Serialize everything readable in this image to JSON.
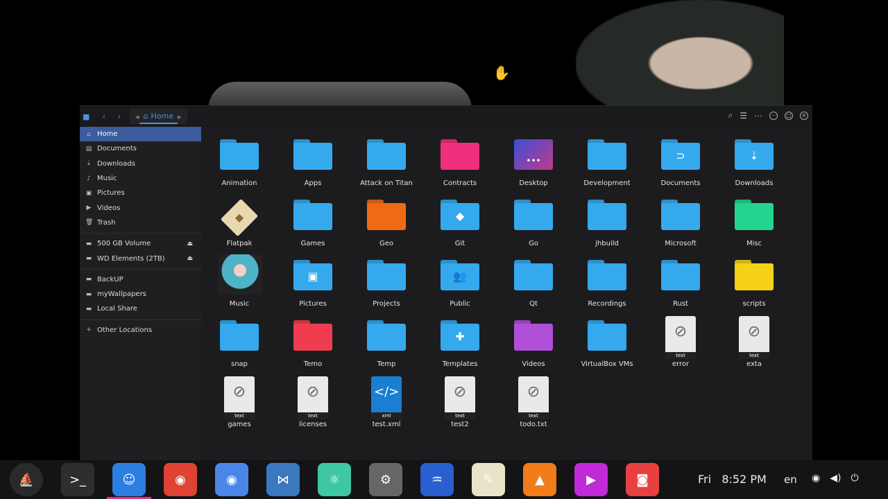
{
  "window": {
    "breadcrumb": "Home"
  },
  "sidebar": {
    "places": [
      {
        "label": "Home",
        "icon": "home-icon"
      },
      {
        "label": "Documents",
        "icon": "document-icon"
      },
      {
        "label": "Downloads",
        "icon": "download-icon"
      },
      {
        "label": "Music",
        "icon": "music-icon"
      },
      {
        "label": "Pictures",
        "icon": "pictures-icon"
      },
      {
        "label": "Videos",
        "icon": "video-icon"
      },
      {
        "label": "Trash",
        "icon": "trash-icon"
      }
    ],
    "devices": [
      {
        "label": "500 GB Volume"
      },
      {
        "label": "WD Elements (2TB)"
      }
    ],
    "bookmarks": [
      {
        "label": "BackUP"
      },
      {
        "label": "myWallpapers"
      },
      {
        "label": "Local Share"
      }
    ],
    "other": "Other Locations"
  },
  "files": [
    {
      "name": "Animation",
      "kind": "folder",
      "color": "#35a9ee"
    },
    {
      "name": "Apps",
      "kind": "folder",
      "color": "#35a9ee"
    },
    {
      "name": "Attack on Titan",
      "kind": "folder",
      "color": "#35a9ee"
    },
    {
      "name": "Contracts",
      "kind": "folder",
      "color": "#ef2f7c"
    },
    {
      "name": "Desktop",
      "kind": "desktop",
      "color": "#7b4fb0"
    },
    {
      "name": "Development",
      "kind": "folder",
      "color": "#35a9ee"
    },
    {
      "name": "Documents",
      "kind": "folder",
      "color": "#35a9ee",
      "glyph": "⊃"
    },
    {
      "name": "Downloads",
      "kind": "folder",
      "color": "#35a9ee",
      "glyph": "⇣"
    },
    {
      "name": "Flatpak",
      "kind": "flatpak",
      "color": "#e8d8b0"
    },
    {
      "name": "Games",
      "kind": "folder",
      "color": "#35a9ee"
    },
    {
      "name": "Geo",
      "kind": "folder",
      "color": "#f06a14"
    },
    {
      "name": "Git",
      "kind": "folder",
      "color": "#35a9ee",
      "glyph": "◆"
    },
    {
      "name": "Go",
      "kind": "folder",
      "color": "#35a9ee"
    },
    {
      "name": "jhbuild",
      "kind": "folder",
      "color": "#35a9ee"
    },
    {
      "name": "Microsoft",
      "kind": "folder",
      "color": "#35a9ee"
    },
    {
      "name": "Misc",
      "kind": "folder",
      "color": "#23d58f"
    },
    {
      "name": "Music",
      "kind": "image",
      "color": "#4fb3c8"
    },
    {
      "name": "Pictures",
      "kind": "folder",
      "color": "#35a9ee",
      "glyph": "▣"
    },
    {
      "name": "Projects",
      "kind": "folder",
      "color": "#35a9ee"
    },
    {
      "name": "Public",
      "kind": "folder",
      "color": "#35a9ee",
      "glyph": "👥"
    },
    {
      "name": "Qt",
      "kind": "folder",
      "color": "#35a9ee"
    },
    {
      "name": "Recordings",
      "kind": "folder",
      "color": "#35a9ee"
    },
    {
      "name": "Rust",
      "kind": "folder",
      "color": "#35a9ee"
    },
    {
      "name": "scripts",
      "kind": "folder",
      "color": "#f5d118"
    },
    {
      "name": "snap",
      "kind": "folder",
      "color": "#35a9ee"
    },
    {
      "name": "Temo",
      "kind": "folder",
      "color": "#ef3d4f"
    },
    {
      "name": "Temp",
      "kind": "folder",
      "color": "#35a9ee"
    },
    {
      "name": "Templates",
      "kind": "folder",
      "color": "#35a9ee",
      "glyph": "✚"
    },
    {
      "name": "Videos",
      "kind": "folder",
      "color": "#b04fd8"
    },
    {
      "name": "VirtualBox VMs",
      "kind": "folder",
      "color": "#35a9ee"
    },
    {
      "name": "error",
      "kind": "text",
      "ftype": "text"
    },
    {
      "name": "exta",
      "kind": "text",
      "ftype": "text"
    },
    {
      "name": "games",
      "kind": "text",
      "ftype": "text"
    },
    {
      "name": "licenses",
      "kind": "text",
      "ftype": "text"
    },
    {
      "name": "test.xml",
      "kind": "xml",
      "ftype": "xml"
    },
    {
      "name": "test2",
      "kind": "text",
      "ftype": "text"
    },
    {
      "name": "todo.txt",
      "kind": "text",
      "ftype": "text"
    }
  ],
  "taskbar": {
    "apps": [
      {
        "name": "launcher",
        "color": "#2a2a2c",
        "glyph": "⛵"
      },
      {
        "name": "terminal",
        "color": "#2e2e30",
        "glyph": ">_"
      },
      {
        "name": "files",
        "color": "#2a7fe0",
        "glyph": "☺",
        "active": true
      },
      {
        "name": "chrome",
        "color": "#e04235",
        "glyph": "◉"
      },
      {
        "name": "chromium",
        "color": "#4a86e8",
        "glyph": "◉"
      },
      {
        "name": "vscode",
        "color": "#3a78c0",
        "glyph": "⋈"
      },
      {
        "name": "atom",
        "color": "#3ec7a0",
        "glyph": "⚛"
      },
      {
        "name": "settings",
        "color": "#666",
        "glyph": "⚙"
      },
      {
        "name": "browser",
        "color": "#2a5fd0",
        "glyph": "♒"
      },
      {
        "name": "notes",
        "color": "#e8e4c8",
        "glyph": "✎"
      },
      {
        "name": "vlc",
        "color": "#f07d1a",
        "glyph": "▲"
      },
      {
        "name": "media-player",
        "color": "#c02ad8",
        "glyph": "▶"
      },
      {
        "name": "camera",
        "color": "#e84040",
        "glyph": "◙"
      }
    ],
    "clock": "Fri   8:52 PM",
    "lang": "en"
  }
}
